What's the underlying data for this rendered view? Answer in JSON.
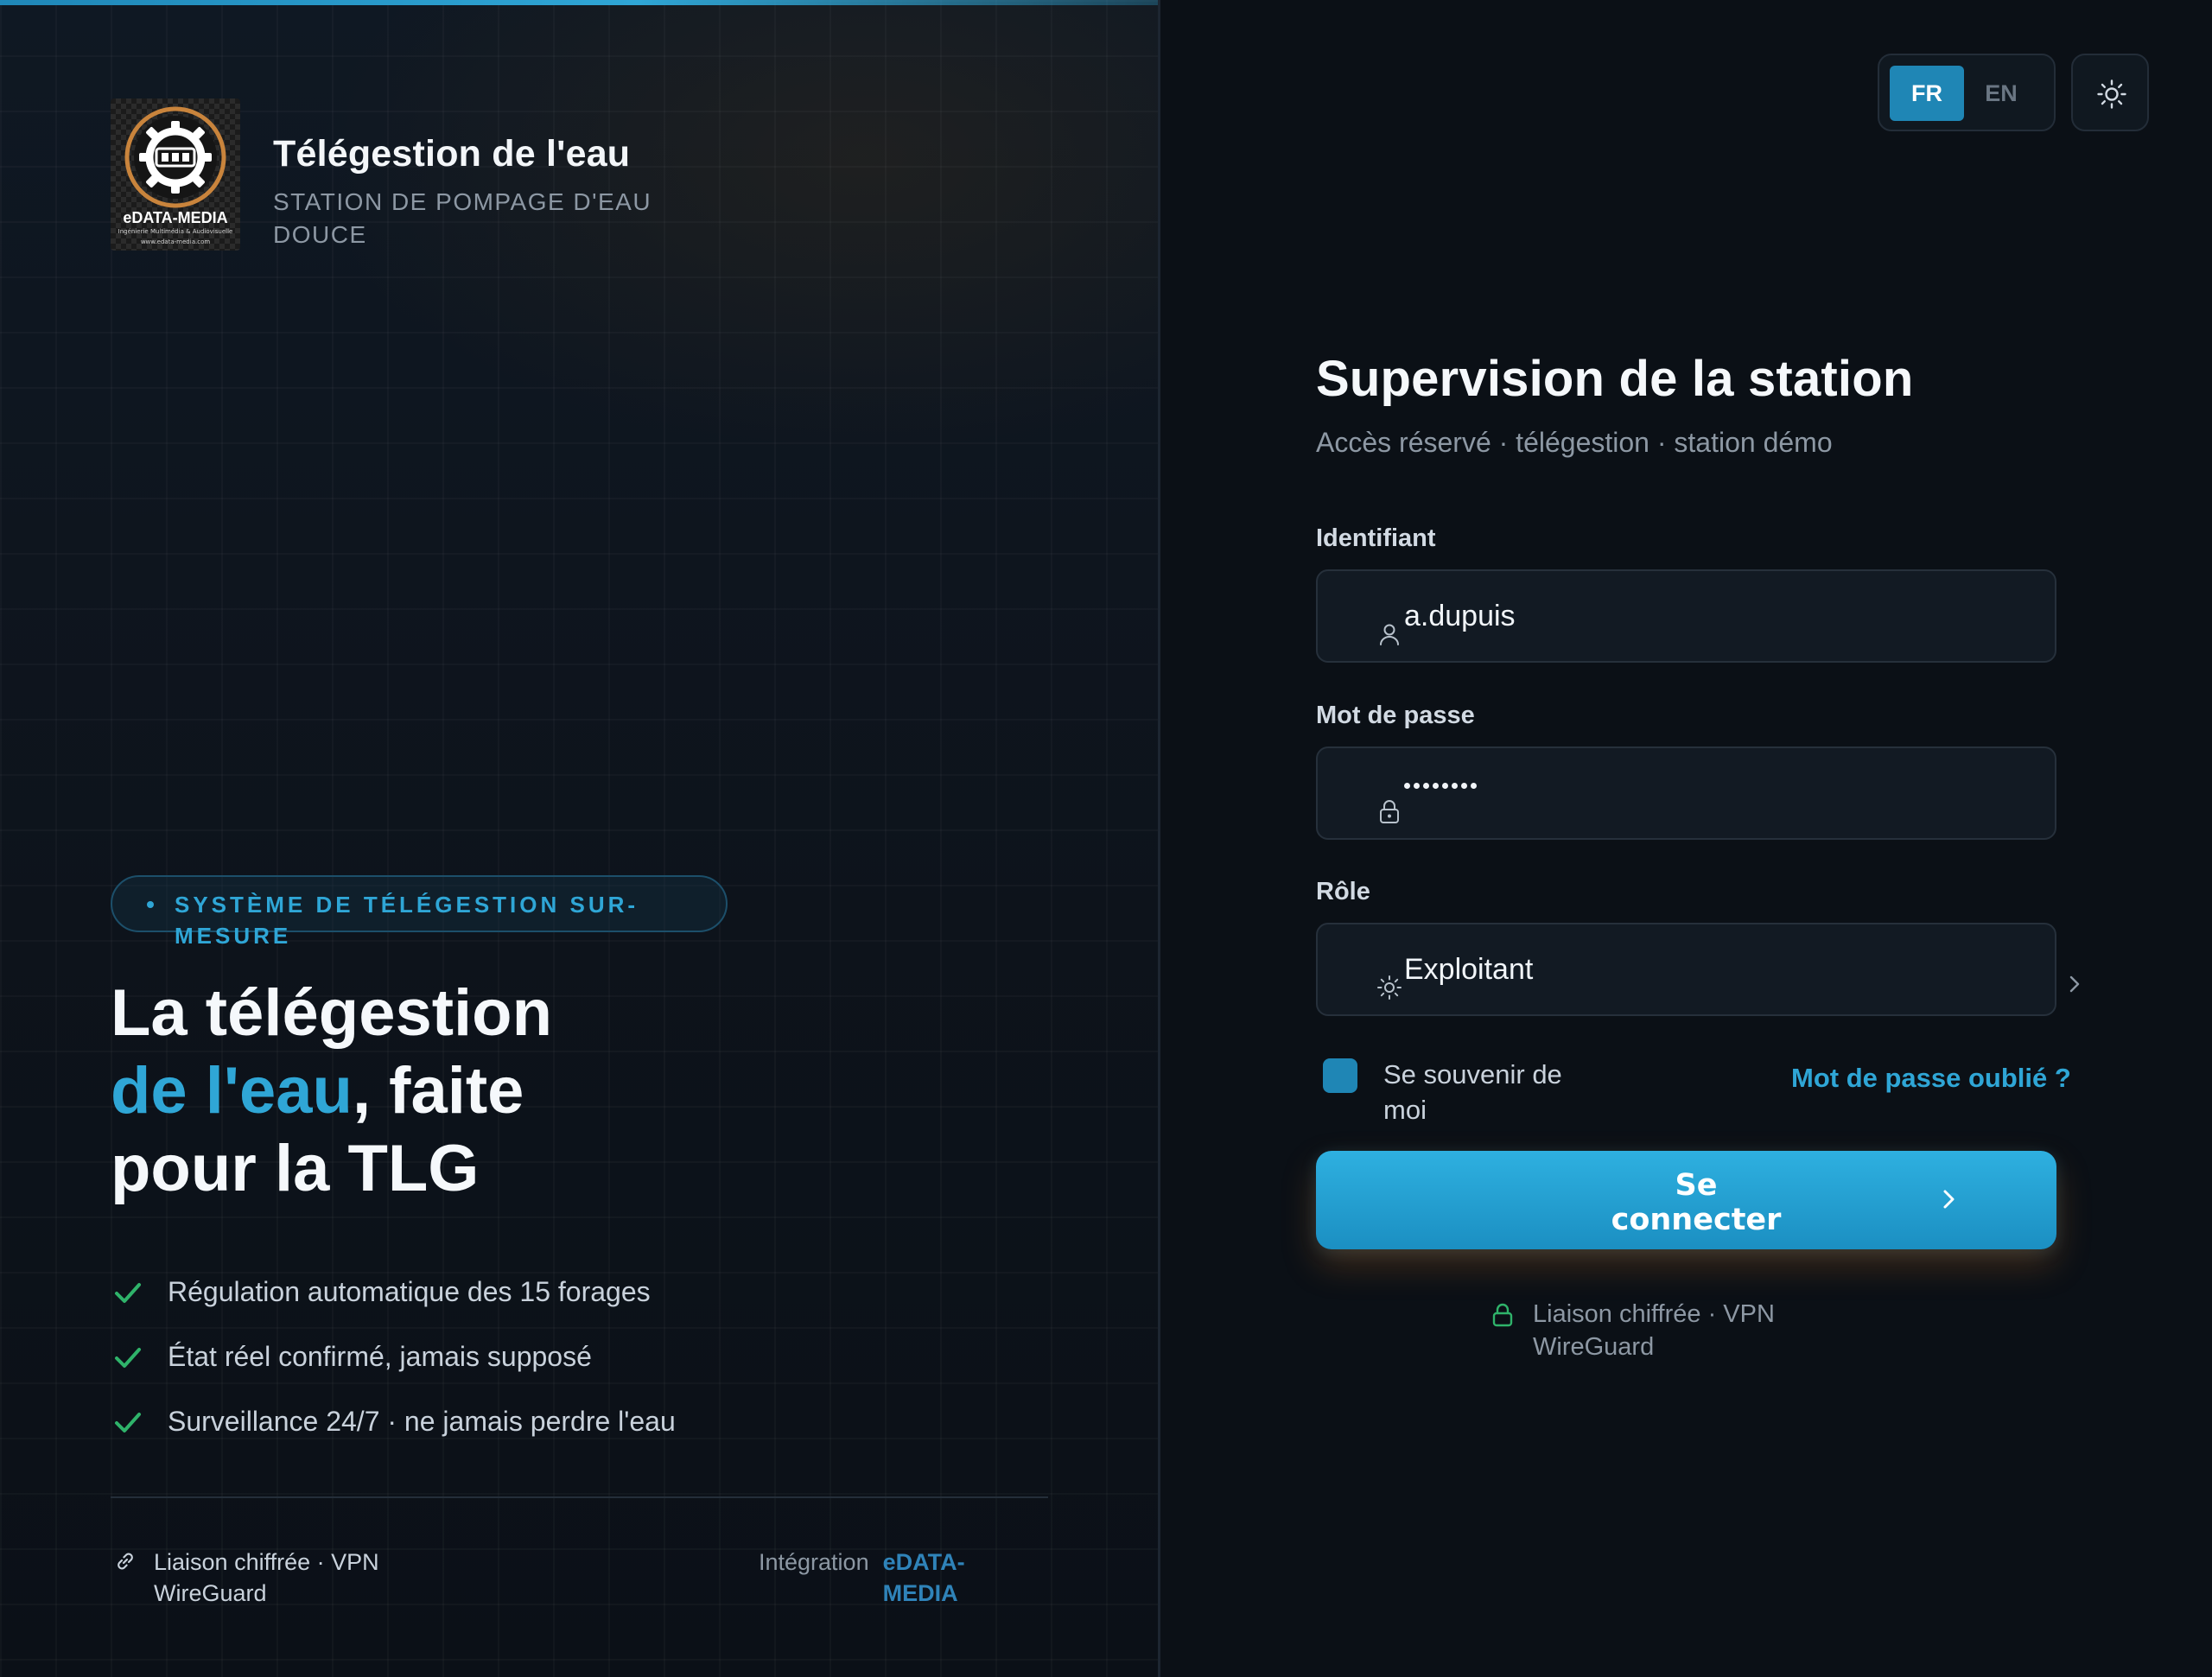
{
  "brand": {
    "logo_text": "eDATA-MEDIA",
    "logo_tagline": "Ingénierie Multimédia & Audiovisuelle",
    "logo_url": "www.edata-media.com",
    "title": "Télégestion de l'eau",
    "subtitle": "STATION DE POMPAGE D'EAU DOUCE"
  },
  "hero": {
    "badge": "SYSTÈME DE TÉLÉGESTION SUR-MESURE",
    "line1": "La télégestion",
    "accent": "de l'eau",
    "line2_rest": ", faite",
    "line3": "pour la TLG"
  },
  "features": [
    {
      "label": "Régulation automatique des 15 forages",
      "icon": "check-icon"
    },
    {
      "label": "État réel confirmé, jamais supposé",
      "icon": "check-icon"
    },
    {
      "label": "Surveillance 24/7 · ne jamais perdre l'eau",
      "icon": "check-icon"
    }
  ],
  "footer": {
    "vpn_label": "Liaison chiffrée · VPN WireGuard",
    "integration_label": "Intégration",
    "integration_brand": "eDATA-MEDIA"
  },
  "header": {
    "lang_fr": "FR",
    "lang_en": "EN",
    "active_lang": "FR",
    "theme_icon": "sun-icon"
  },
  "login": {
    "title": "Supervision de la station",
    "subtitle": "Accès réservé · télégestion · station démo",
    "username_label": "Identifiant",
    "username_value": "a.dupuis",
    "password_label": "Mot de passe",
    "password_mask_length": 8,
    "role_label": "Rôle",
    "role_value": "Exploitant",
    "remember_label": "Se souvenir de moi",
    "remember_checked": true,
    "forgot_label": "Mot de passe oublié ?",
    "submit_label": "Se connecter",
    "secure_label": "Liaison chiffrée · VPN WireGuard"
  },
  "colors": {
    "accent": "#2fa6d6",
    "accent_dark": "#1f86b5",
    "check": "#2fb36a",
    "background": "#0b1016",
    "text_muted": "#8d98a4"
  }
}
